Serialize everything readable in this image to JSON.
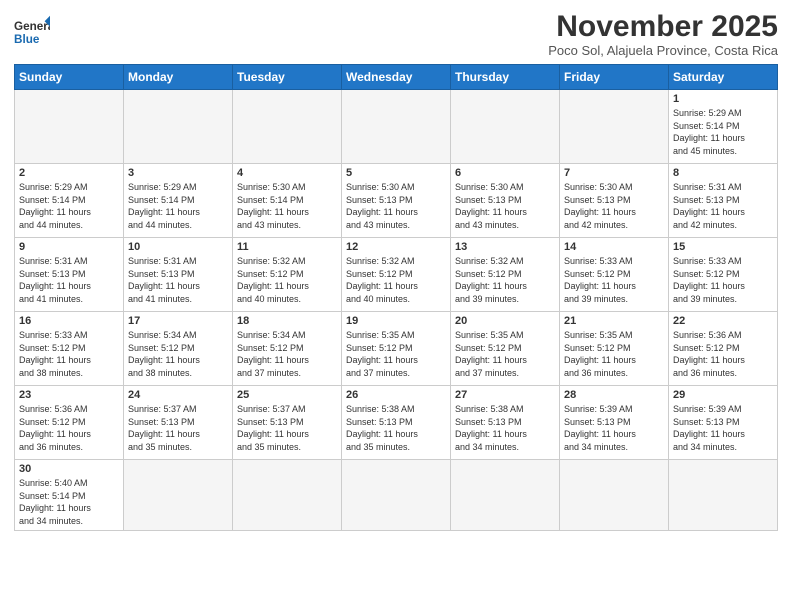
{
  "header": {
    "logo_general": "General",
    "logo_blue": "Blue",
    "month_title": "November 2025",
    "subtitle": "Poco Sol, Alajuela Province, Costa Rica"
  },
  "weekdays": [
    "Sunday",
    "Monday",
    "Tuesday",
    "Wednesday",
    "Thursday",
    "Friday",
    "Saturday"
  ],
  "weeks": [
    [
      {
        "day": "",
        "info": ""
      },
      {
        "day": "",
        "info": ""
      },
      {
        "day": "",
        "info": ""
      },
      {
        "day": "",
        "info": ""
      },
      {
        "day": "",
        "info": ""
      },
      {
        "day": "",
        "info": ""
      },
      {
        "day": "1",
        "info": "Sunrise: 5:29 AM\nSunset: 5:14 PM\nDaylight: 11 hours\nand 45 minutes."
      }
    ],
    [
      {
        "day": "2",
        "info": "Sunrise: 5:29 AM\nSunset: 5:14 PM\nDaylight: 11 hours\nand 44 minutes."
      },
      {
        "day": "3",
        "info": "Sunrise: 5:29 AM\nSunset: 5:14 PM\nDaylight: 11 hours\nand 44 minutes."
      },
      {
        "day": "4",
        "info": "Sunrise: 5:30 AM\nSunset: 5:14 PM\nDaylight: 11 hours\nand 43 minutes."
      },
      {
        "day": "5",
        "info": "Sunrise: 5:30 AM\nSunset: 5:13 PM\nDaylight: 11 hours\nand 43 minutes."
      },
      {
        "day": "6",
        "info": "Sunrise: 5:30 AM\nSunset: 5:13 PM\nDaylight: 11 hours\nand 43 minutes."
      },
      {
        "day": "7",
        "info": "Sunrise: 5:30 AM\nSunset: 5:13 PM\nDaylight: 11 hours\nand 42 minutes."
      },
      {
        "day": "8",
        "info": "Sunrise: 5:31 AM\nSunset: 5:13 PM\nDaylight: 11 hours\nand 42 minutes."
      }
    ],
    [
      {
        "day": "9",
        "info": "Sunrise: 5:31 AM\nSunset: 5:13 PM\nDaylight: 11 hours\nand 41 minutes."
      },
      {
        "day": "10",
        "info": "Sunrise: 5:31 AM\nSunset: 5:13 PM\nDaylight: 11 hours\nand 41 minutes."
      },
      {
        "day": "11",
        "info": "Sunrise: 5:32 AM\nSunset: 5:12 PM\nDaylight: 11 hours\nand 40 minutes."
      },
      {
        "day": "12",
        "info": "Sunrise: 5:32 AM\nSunset: 5:12 PM\nDaylight: 11 hours\nand 40 minutes."
      },
      {
        "day": "13",
        "info": "Sunrise: 5:32 AM\nSunset: 5:12 PM\nDaylight: 11 hours\nand 39 minutes."
      },
      {
        "day": "14",
        "info": "Sunrise: 5:33 AM\nSunset: 5:12 PM\nDaylight: 11 hours\nand 39 minutes."
      },
      {
        "day": "15",
        "info": "Sunrise: 5:33 AM\nSunset: 5:12 PM\nDaylight: 11 hours\nand 39 minutes."
      }
    ],
    [
      {
        "day": "16",
        "info": "Sunrise: 5:33 AM\nSunset: 5:12 PM\nDaylight: 11 hours\nand 38 minutes."
      },
      {
        "day": "17",
        "info": "Sunrise: 5:34 AM\nSunset: 5:12 PM\nDaylight: 11 hours\nand 38 minutes."
      },
      {
        "day": "18",
        "info": "Sunrise: 5:34 AM\nSunset: 5:12 PM\nDaylight: 11 hours\nand 37 minutes."
      },
      {
        "day": "19",
        "info": "Sunrise: 5:35 AM\nSunset: 5:12 PM\nDaylight: 11 hours\nand 37 minutes."
      },
      {
        "day": "20",
        "info": "Sunrise: 5:35 AM\nSunset: 5:12 PM\nDaylight: 11 hours\nand 37 minutes."
      },
      {
        "day": "21",
        "info": "Sunrise: 5:35 AM\nSunset: 5:12 PM\nDaylight: 11 hours\nand 36 minutes."
      },
      {
        "day": "22",
        "info": "Sunrise: 5:36 AM\nSunset: 5:12 PM\nDaylight: 11 hours\nand 36 minutes."
      }
    ],
    [
      {
        "day": "23",
        "info": "Sunrise: 5:36 AM\nSunset: 5:12 PM\nDaylight: 11 hours\nand 36 minutes."
      },
      {
        "day": "24",
        "info": "Sunrise: 5:37 AM\nSunset: 5:13 PM\nDaylight: 11 hours\nand 35 minutes."
      },
      {
        "day": "25",
        "info": "Sunrise: 5:37 AM\nSunset: 5:13 PM\nDaylight: 11 hours\nand 35 minutes."
      },
      {
        "day": "26",
        "info": "Sunrise: 5:38 AM\nSunset: 5:13 PM\nDaylight: 11 hours\nand 35 minutes."
      },
      {
        "day": "27",
        "info": "Sunrise: 5:38 AM\nSunset: 5:13 PM\nDaylight: 11 hours\nand 34 minutes."
      },
      {
        "day": "28",
        "info": "Sunrise: 5:39 AM\nSunset: 5:13 PM\nDaylight: 11 hours\nand 34 minutes."
      },
      {
        "day": "29",
        "info": "Sunrise: 5:39 AM\nSunset: 5:13 PM\nDaylight: 11 hours\nand 34 minutes."
      }
    ],
    [
      {
        "day": "30",
        "info": "Sunrise: 5:40 AM\nSunset: 5:14 PM\nDaylight: 11 hours\nand 34 minutes."
      },
      {
        "day": "",
        "info": ""
      },
      {
        "day": "",
        "info": ""
      },
      {
        "day": "",
        "info": ""
      },
      {
        "day": "",
        "info": ""
      },
      {
        "day": "",
        "info": ""
      },
      {
        "day": "",
        "info": ""
      }
    ]
  ]
}
